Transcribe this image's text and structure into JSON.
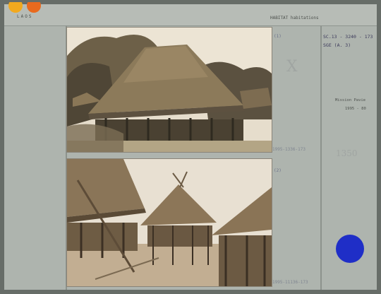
{
  "header": {
    "country": "LAOS",
    "topic": "HABITAT  habitations",
    "logo_icon": "bnf-logo-icon",
    "logo_colors": [
      "#f2a91e",
      "#e96a1e"
    ]
  },
  "photos": [
    {
      "number": "(1)",
      "pencil_note": "1995-1336-173"
    },
    {
      "number": "(2)",
      "pencil_note": "1995-11136-173"
    }
  ],
  "cote": {
    "line1": "SC.13 - 3240 - 173",
    "line2": "SGE (A. 3)"
  },
  "mission": {
    "name": "Mission Pavie",
    "years": "1995 - 80"
  },
  "faint_marks": {
    "cross": "X",
    "number": "1350"
  },
  "sticker": {
    "color": "#1f2ec7"
  }
}
